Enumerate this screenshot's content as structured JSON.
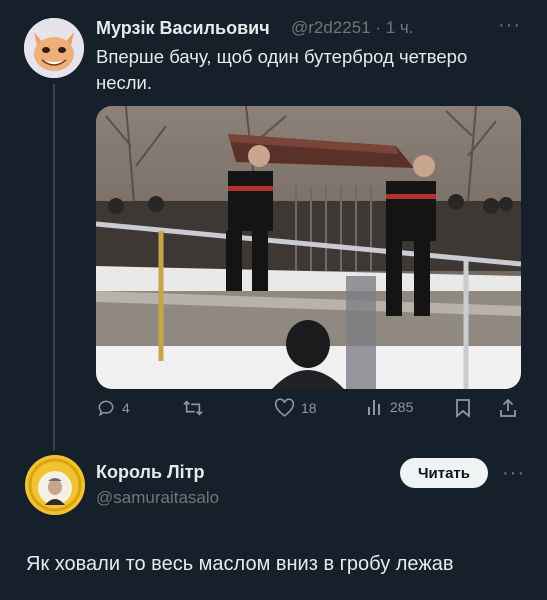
{
  "tweet1": {
    "author_name": "Мурзік Васильович",
    "meta": "@r2d2251 · 1 ч.",
    "text": "Вперше бачу, щоб один бутерброд четверо несли.",
    "actions": {
      "replies": "4",
      "retweets": "",
      "likes": "18",
      "views": "285"
    }
  },
  "tweet2": {
    "author_name": "Король Літр",
    "handle": "@samuraitasalo",
    "follow_label": "Читать",
    "text": "Як ховали то весь маслом вниз в гробу лежав"
  },
  "colors": {
    "background": "#15202b",
    "primary_text": "#e7e9ea",
    "secondary_text": "#71767b",
    "follow_button_bg": "#eff3f4"
  },
  "icons": [
    "reply-icon",
    "retweet-icon",
    "like-icon",
    "views-icon",
    "bookmark-icon",
    "share-icon",
    "more-icon"
  ]
}
